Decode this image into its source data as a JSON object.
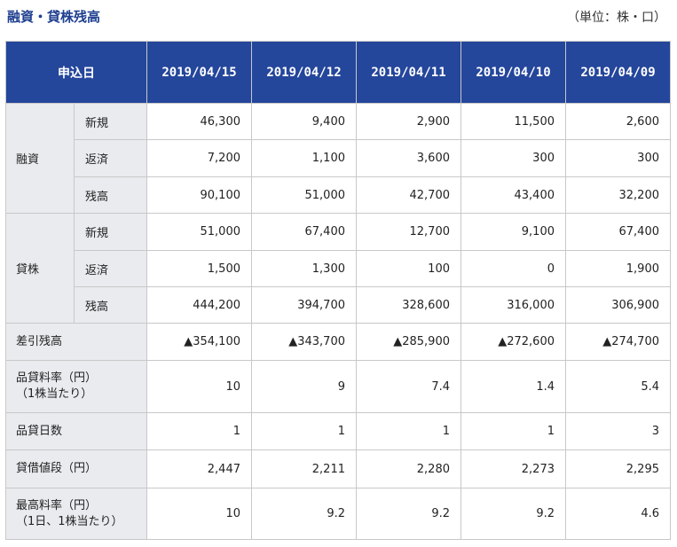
{
  "title": "融資・貸株残高",
  "unit_note": "（単位：株・口）",
  "header": {
    "corner": "申込日",
    "dates": [
      "2019/04/15",
      "2019/04/12",
      "2019/04/11",
      "2019/04/10",
      "2019/04/09"
    ]
  },
  "groups": {
    "margin": {
      "label": "融資",
      "rows": [
        {
          "label": "新規",
          "values": [
            "46,300",
            "9,400",
            "2,900",
            "11,500",
            "2,600"
          ]
        },
        {
          "label": "返済",
          "values": [
            "7,200",
            "1,100",
            "3,600",
            "300",
            "300"
          ]
        },
        {
          "label": "残高",
          "values": [
            "90,100",
            "51,000",
            "42,700",
            "43,400",
            "32,200"
          ]
        }
      ]
    },
    "lending": {
      "label": "貸株",
      "rows": [
        {
          "label": "新規",
          "values": [
            "51,000",
            "67,400",
            "12,700",
            "9,100",
            "67,400"
          ]
        },
        {
          "label": "返済",
          "values": [
            "1,500",
            "1,300",
            "100",
            "0",
            "1,900"
          ]
        },
        {
          "label": "残高",
          "values": [
            "444,200",
            "394,700",
            "328,600",
            "316,000",
            "306,900"
          ]
        }
      ]
    }
  },
  "rows": {
    "net_balance": {
      "label": "差引残高",
      "values": [
        "▲354,100",
        "▲343,700",
        "▲285,900",
        "▲272,600",
        "▲274,700"
      ]
    },
    "lending_fee": {
      "label_line1": "品貸料率（円）",
      "label_line2": "（1株当たり）",
      "values": [
        "10",
        "9",
        "7.4",
        "1.4",
        "5.4"
      ]
    },
    "lending_days": {
      "label": "品貸日数",
      "values": [
        "1",
        "1",
        "1",
        "1",
        "3"
      ]
    },
    "borrow_price": {
      "label": "貸借値段（円）",
      "values": [
        "2,447",
        "2,211",
        "2,280",
        "2,273",
        "2,295"
      ]
    },
    "max_fee": {
      "label_line1": "最高料率（円）",
      "label_line2": "（1日、1株当たり）",
      "values": [
        "10",
        "9.2",
        "9.2",
        "9.2",
        "4.6"
      ]
    }
  },
  "colors": {
    "header_bg": "#24469b",
    "title": "#1f3f8f",
    "label_bg": "#e9ebee",
    "border": "#c8c8c8"
  }
}
